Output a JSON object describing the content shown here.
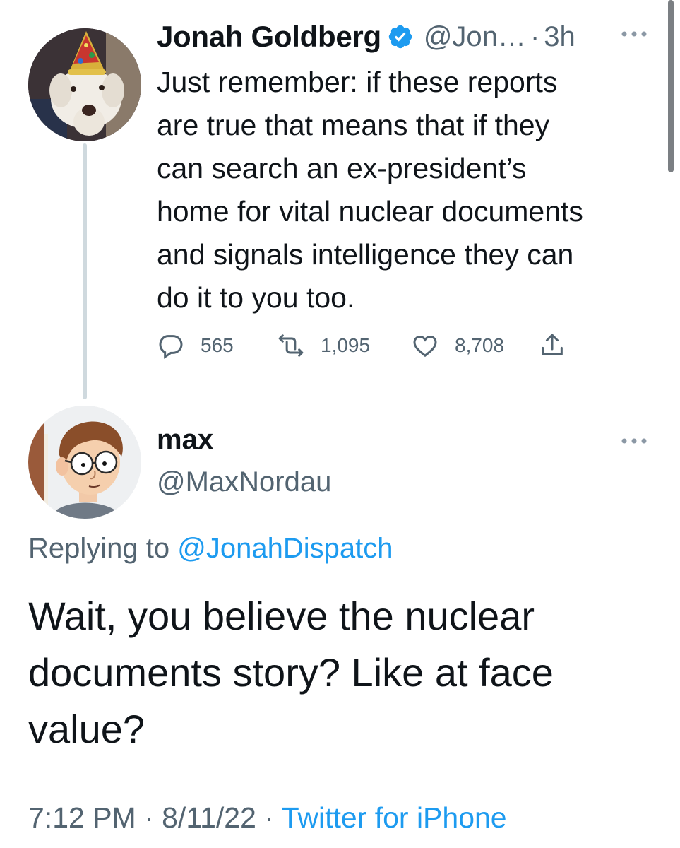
{
  "parent_tweet": {
    "author_name": "Jonah Goldberg",
    "handle": "@Jon…",
    "separator": "·",
    "time": "3h",
    "verified": true,
    "text": "Just remember: if these reports\nare true that means that if they\ncan search an ex-president’s\nhome for vital nuclear documents\nand signals intelligence they can\ndo it to you too.",
    "replies": "565",
    "retweets": "1,095",
    "likes": "8,708",
    "avatar": "dog-in-party-hat"
  },
  "reply_tweet": {
    "author_name": "max",
    "handle": "@MaxNordau",
    "replying_prefix": "Replying to ",
    "replying_to": "@JonahDispatch",
    "text": "Wait, you believe the nuclear\ndocuments story? Like at face\nvalue?",
    "timestamp": "7:12 PM · 8/11/22 · ",
    "source": "Twitter for iPhone",
    "avatar": "cartoon-man-with-glasses"
  },
  "icons": [
    "verified-badge-icon",
    "more-icon",
    "reply-icon",
    "retweet-icon",
    "like-icon",
    "share-icon"
  ],
  "colors": {
    "text": "#0f1419",
    "secondary": "#536471",
    "accent": "#1d9bf0",
    "thread_line": "#cfd9de"
  }
}
